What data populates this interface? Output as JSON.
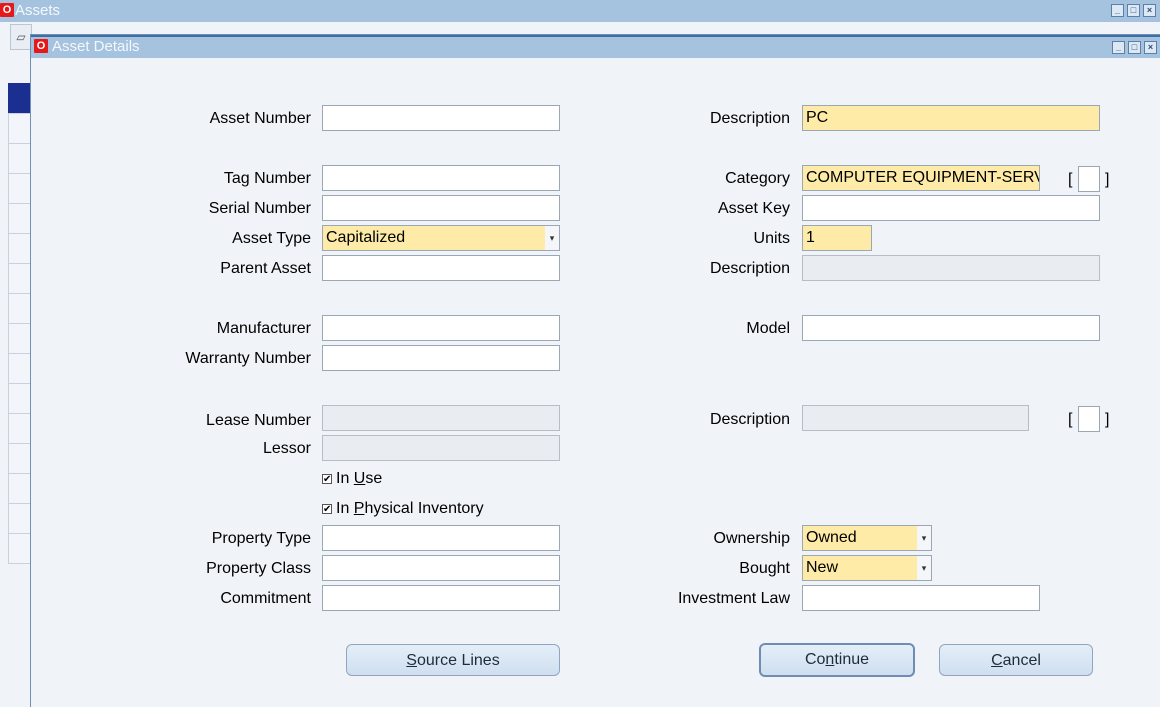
{
  "outer_window": {
    "title": "Assets",
    "logo": "O",
    "controls": [
      "minimize-icon",
      "maximize-icon",
      "close-icon"
    ]
  },
  "inner_window": {
    "title": "Asset Details",
    "logo": "O",
    "controls": [
      "minimize-icon",
      "maximize-icon",
      "close-icon"
    ]
  },
  "form": {
    "asset_number": {
      "label": "Asset Number",
      "value": ""
    },
    "description": {
      "label": "Description",
      "value": "PC"
    },
    "tag_number": {
      "label": "Tag Number",
      "value": ""
    },
    "category": {
      "label": "Category",
      "value": "COMPUTER EQUIPMENT-SERV"
    },
    "serial_number": {
      "label": "Serial Number",
      "value": ""
    },
    "asset_key": {
      "label": "Asset Key",
      "value": ""
    },
    "asset_type": {
      "label": "Asset Type",
      "value": "Capitalized"
    },
    "units": {
      "label": "Units",
      "value": "1"
    },
    "parent_asset": {
      "label": "Parent Asset",
      "value": ""
    },
    "parent_description": {
      "label": "Description",
      "value": ""
    },
    "manufacturer": {
      "label": "Manufacturer",
      "value": ""
    },
    "model": {
      "label": "Model",
      "value": ""
    },
    "warranty_number": {
      "label": "Warranty Number",
      "value": ""
    },
    "lease_number": {
      "label": "Lease Number",
      "value": ""
    },
    "lease_description": {
      "label": "Description",
      "value": ""
    },
    "lessor": {
      "label": "Lessor",
      "value": ""
    },
    "in_use": {
      "pre": "In ",
      "accel": "U",
      "post": "se",
      "checked": true
    },
    "in_physical_inventory": {
      "pre": "In ",
      "accel": "P",
      "post": "hysical Inventory",
      "checked": true
    },
    "property_type": {
      "label": "Property Type",
      "value": ""
    },
    "ownership": {
      "label": "Ownership",
      "value": "Owned"
    },
    "property_class": {
      "label": "Property Class",
      "value": ""
    },
    "bought": {
      "label": "Bought",
      "value": "New"
    },
    "commitment": {
      "label": "Commitment",
      "value": ""
    },
    "investment_law": {
      "label": "Investment Law",
      "value": ""
    },
    "bracket_open": "[",
    "bracket_close": "]",
    "dropdown_glyph": "▾",
    "check_glyph": "✔"
  },
  "buttons": {
    "source_lines": {
      "accel": "S",
      "rest": "ource Lines"
    },
    "continue": {
      "pre": "Co",
      "accel": "n",
      "post": "tinue"
    },
    "cancel": {
      "accel": "C",
      "rest": "ancel"
    }
  },
  "colors": {
    "titlebar": "#a5c2de",
    "required_field": "#fdeba7",
    "readonly_field": "#e9edf1",
    "oracle_red": "#e51919"
  }
}
